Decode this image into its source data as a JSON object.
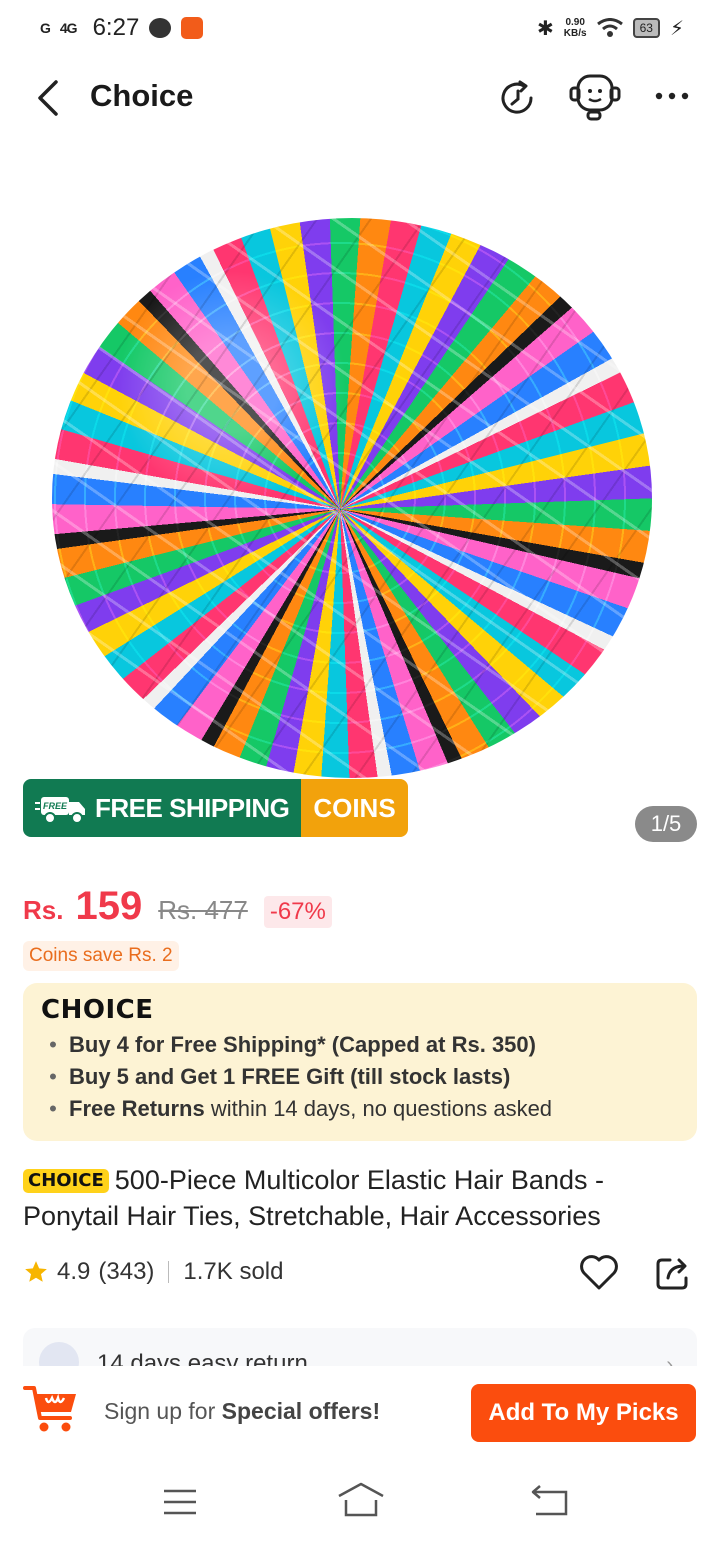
{
  "status_bar": {
    "signal1": "G",
    "signal2": "4G",
    "time": "6:27",
    "speed_value": "0.90",
    "speed_unit": "KB/s",
    "battery": "63"
  },
  "nav": {
    "title": "Choice"
  },
  "product_image": {
    "shipping_label": "FREE SHIPPING",
    "truck_label": "FREE",
    "coins_label": "COINS",
    "counter": "1/5"
  },
  "price": {
    "currency": "Rs.",
    "current": "159",
    "original": "Rs. 477",
    "discount": "-67%"
  },
  "coins_save": "Coins save Rs. 2",
  "choice_box": {
    "logo": "CHOICE",
    "items": [
      {
        "bold": "Buy 4 for  Free Shipping* (Capped at Rs. 350)",
        "rest": ""
      },
      {
        "bold": "Buy 5 and Get 1 FREE Gift (till stock lasts)",
        "rest": ""
      },
      {
        "bold": "Free Returns",
        "rest": " within 14 days, no questions asked"
      }
    ]
  },
  "product": {
    "tag": "CHOICE",
    "title": "500-Piece Multicolor Elastic Hair Bands - Ponytail Hair Ties, Stretchable, Hair Accessories",
    "rating": "4.9",
    "reviews": "(343)",
    "sold": "1.7K sold"
  },
  "return_policy": "14 days easy return",
  "action_bar": {
    "signup_prefix": "Sign up for ",
    "signup_bold": "Special offers!",
    "button": "Add To My Picks"
  },
  "colors": {
    "accent": "#fb4d0e",
    "price": "#f0394a",
    "shipping_green": "#117a52",
    "coins_orange": "#f2a20c",
    "choice_bg": "#fdf3d4"
  }
}
